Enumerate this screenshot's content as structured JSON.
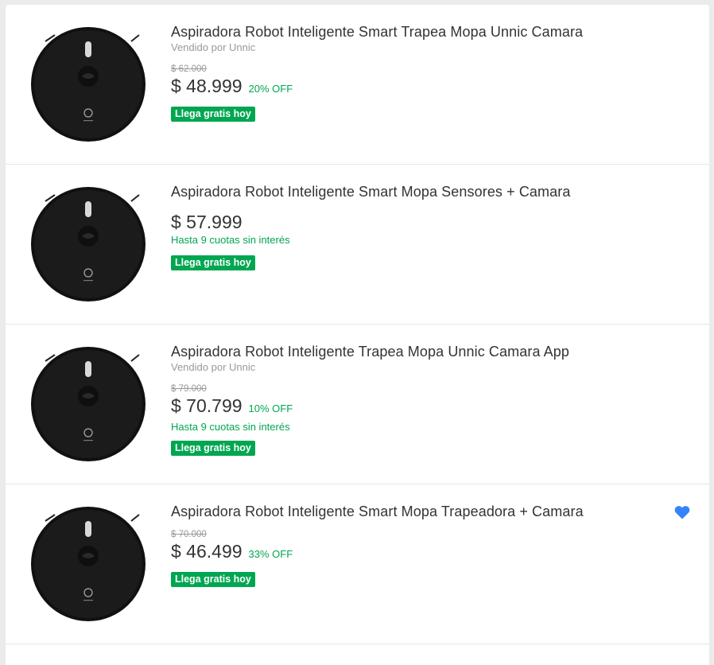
{
  "items": [
    {
      "title": "Aspiradora Robot Inteligente Smart Trapea Mopa Unnic Camara",
      "seller": "Vendido por Unnic",
      "old_price": "$ 62.000",
      "price": "$ 48.999",
      "discount": "20% OFF",
      "installments": "",
      "badge": "Llega gratis hoy",
      "favorited": false
    },
    {
      "title": "Aspiradora Robot Inteligente Smart Mopa Sensores + Camara",
      "seller": "",
      "old_price": "",
      "price": "$ 57.999",
      "discount": "",
      "installments": "Hasta 9 cuotas sin interés",
      "badge": "Llega gratis hoy",
      "favorited": false
    },
    {
      "title": "Aspiradora Robot Inteligente Trapea Mopa Unnic Camara App",
      "seller": "Vendido por Unnic",
      "old_price": "$ 79.000",
      "price": "$ 70.799",
      "discount": "10% OFF",
      "installments": "Hasta 9 cuotas sin interés",
      "badge": "Llega gratis hoy",
      "favorited": false
    },
    {
      "title": "Aspiradora Robot Inteligente Smart Mopa Trapeadora + Camara",
      "seller": "",
      "old_price": "$ 70.000",
      "price": "$ 46.499",
      "discount": "33% OFF",
      "installments": "",
      "badge": "Llega gratis hoy",
      "favorited": true
    }
  ],
  "colors": {
    "accent_green": "#00a650",
    "favorite_blue": "#3483fa"
  },
  "icons": {
    "thumbnail": "robot-vacuum-icon",
    "favorite": "heart-icon"
  }
}
